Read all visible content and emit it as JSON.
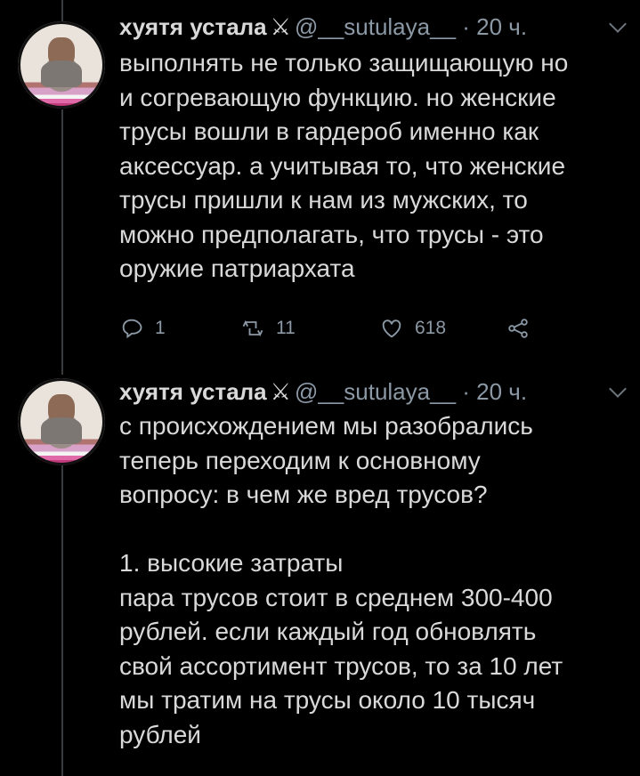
{
  "tweets": [
    {
      "author_name": "хуятя устала",
      "badge": "⚔",
      "handle": "@__sutulaya__",
      "time": "· 20 ч.",
      "text": "выполнять не только защищающую но\nи согревающую функцию. но женские\nтрусы вошли в гардероб именно как\nаксессуар. а учитывая то, что женские\nтрусы пришли к нам из мужских, то\nможно предполагать, что трусы - это\nоружие патриархата",
      "replies": "1",
      "retweets": "11",
      "likes": "618",
      "icons": {
        "reply": "reply-icon",
        "retweet": "retweet-icon",
        "like": "heart-icon",
        "share": "share-icon",
        "more": "chevron-down-icon"
      }
    },
    {
      "author_name": "хуятя устала",
      "badge": "⚔",
      "handle": "@__sutulaya__",
      "time": "· 20 ч.",
      "text": "с происхождением мы разобрались\nтеперь переходим к основному\nвопросу: в чем же вред трусов?\n\n1. высокие затраты\nпара трусов стоит в среднем 300-400\nрублей. если каждый год обновлять\nсвой ассортимент трусов, то за 10 лет\nмы тратим на трусы около 10 тысяч\nрублей"
    }
  ],
  "colors": {
    "background": "#000000",
    "text": "#d9d9d9",
    "muted": "#8b98a5",
    "thread_line": "#3a3d40"
  }
}
